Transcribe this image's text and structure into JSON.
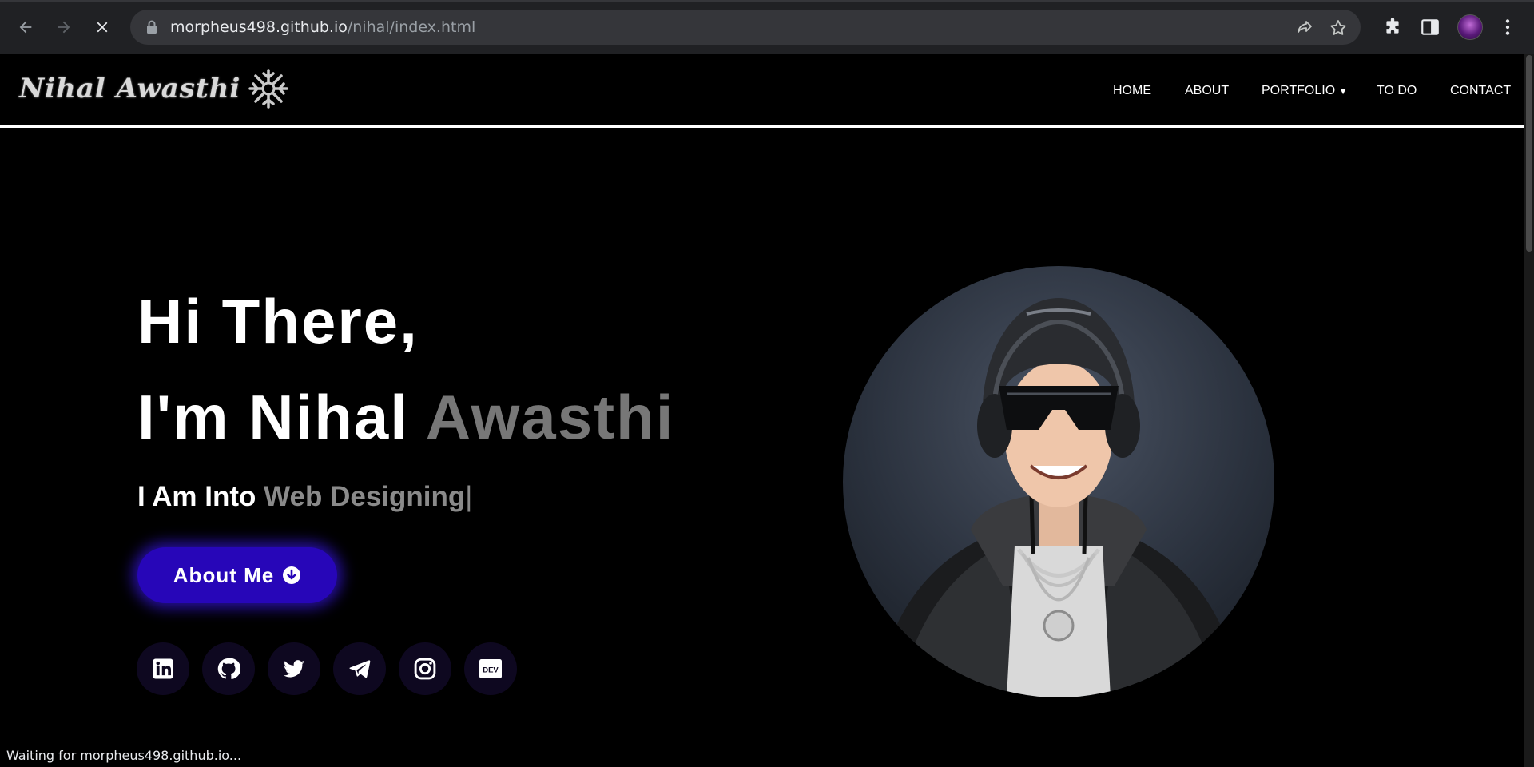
{
  "browser": {
    "url_host": "morpheus498.github.io",
    "url_path": "/nihal/index.html",
    "status": "Waiting for morpheus498.github.io..."
  },
  "site": {
    "logo_text": "Nihal Awasthi",
    "nav": [
      {
        "label": "HOME"
      },
      {
        "label": "ABOUT"
      },
      {
        "label": "PORTFOLIO"
      },
      {
        "label": "TO DO"
      },
      {
        "label": "CONTACT"
      }
    ],
    "hero": {
      "line1": "Hi There,",
      "line2_white": "I'm Nihal ",
      "line2_grey": "Awasthi",
      "tag_white": "I Am Into ",
      "tag_grey": "Web Designing",
      "tag_cursor": "|",
      "button_label": "About Me"
    },
    "social": [
      {
        "icon": "linkedin-icon"
      },
      {
        "icon": "github-icon"
      },
      {
        "icon": "twitter-icon"
      },
      {
        "icon": "telegram-icon"
      },
      {
        "icon": "instagram-icon"
      },
      {
        "icon": "dev-icon",
        "label": "DEV"
      }
    ]
  },
  "colors": {
    "button_bg": "#2706b8",
    "accent_grey": "#777777",
    "social_bg": "#0e0820"
  }
}
